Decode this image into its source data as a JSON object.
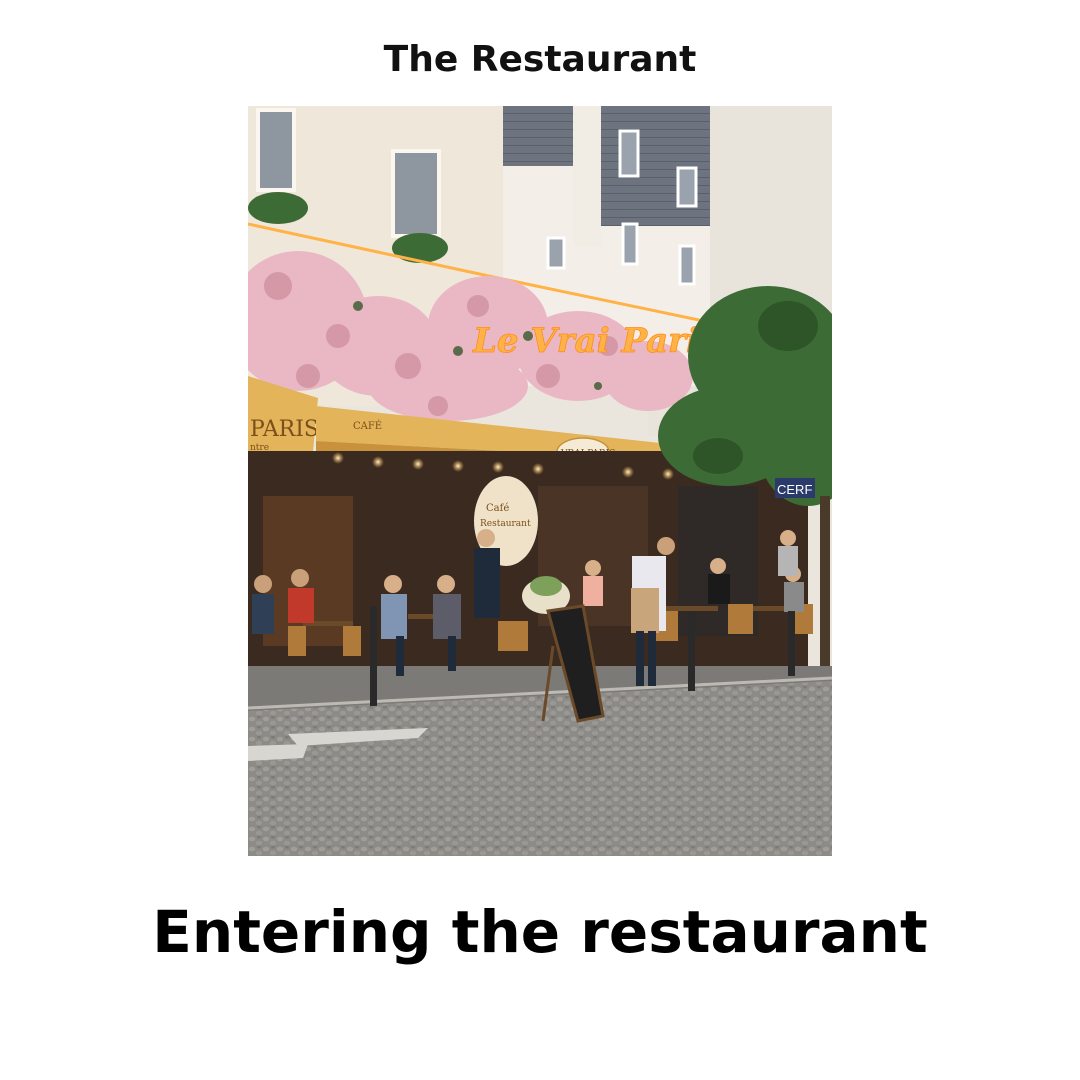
{
  "header": {
    "title": "The Restaurant"
  },
  "photo": {
    "subject": "Parisian café terrace with diners seated outside",
    "neon_sign": "Le Vrai Paris",
    "awning_left": "PARIS",
    "awning_left_small": "ntre",
    "awning_cafe": "CAFÉ",
    "awning_badge": "VRAI PARIS",
    "corner_sign": "CERF",
    "window_board": [
      "Café",
      "Restaurant"
    ]
  },
  "caption": {
    "text": "Entering the restaurant"
  },
  "colors": {
    "awning": "#e3b45a",
    "neon": "#ffb347",
    "stone": "#efe7da",
    "roof": "#6f7580",
    "street": "#8c8a86",
    "foliage": "#3d6b35",
    "blossom": "#e9b8c4"
  }
}
